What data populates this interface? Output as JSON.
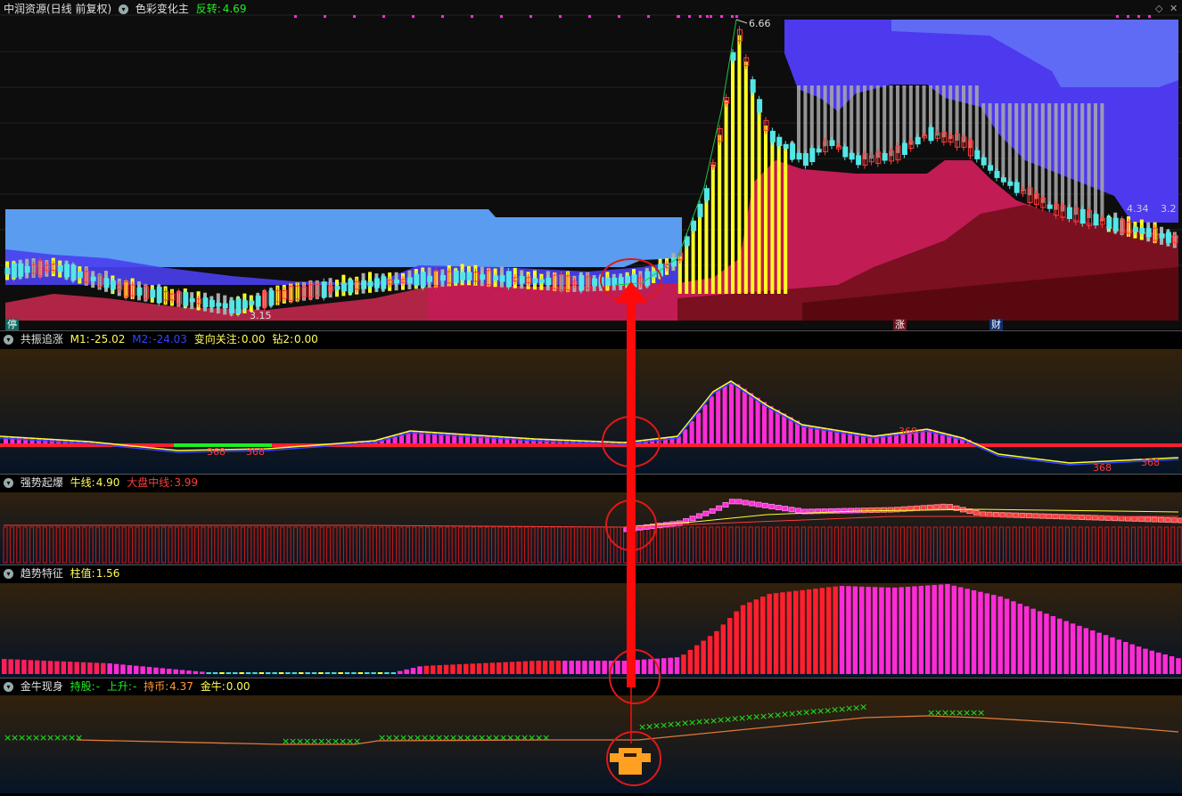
{
  "panel_main": {
    "title": "中润资源(日线 前复权)",
    "indicator": "色彩变化主",
    "label": "反转:",
    "value": "4.69",
    "price_high": "6.66",
    "price_low": "3.15",
    "right_label_1": "4.34",
    "right_label_2": "3.2",
    "badges": [
      "停",
      "涨",
      "财"
    ]
  },
  "panel_1": {
    "name": "共振追涨",
    "items": [
      {
        "label": "M1:",
        "value": "-25.02"
      },
      {
        "label": "M2:",
        "value": "-24.03"
      },
      {
        "label": "变向关注:",
        "value": "0.00"
      },
      {
        "label": "钻2:",
        "value": "0.00"
      }
    ],
    "marker_text": "368"
  },
  "panel_2": {
    "name": "强势起爆",
    "items": [
      {
        "label": "牛线:",
        "value": "4.90"
      },
      {
        "label": "大盘中线:",
        "value": "3.99"
      }
    ]
  },
  "panel_3": {
    "name": "趋势特征",
    "items": [
      {
        "label": "柱值:",
        "value": "1.56"
      }
    ]
  },
  "panel_4": {
    "name": "金牛现身",
    "items": [
      {
        "label": "持股:",
        "value": "-"
      },
      {
        "label": "上升:",
        "value": "-"
      },
      {
        "label": "持币:",
        "value": "4.37"
      },
      {
        "label": "金牛:",
        "value": "0.00"
      }
    ]
  },
  "controls": {
    "toggle_icon": "chevron-down-icon",
    "expand_icon": "diamond-icon",
    "close_icon": "close-icon"
  },
  "colors": {
    "up": "#ff3b3b",
    "down": "#55e6e6",
    "magenta": "#ff2bd6",
    "yellow": "#ffff33",
    "green": "#22ee22",
    "blue_cloud": "#5a3cf5",
    "sky_cloud": "#5a9cf0",
    "red_cloud": "#c0304a"
  }
}
